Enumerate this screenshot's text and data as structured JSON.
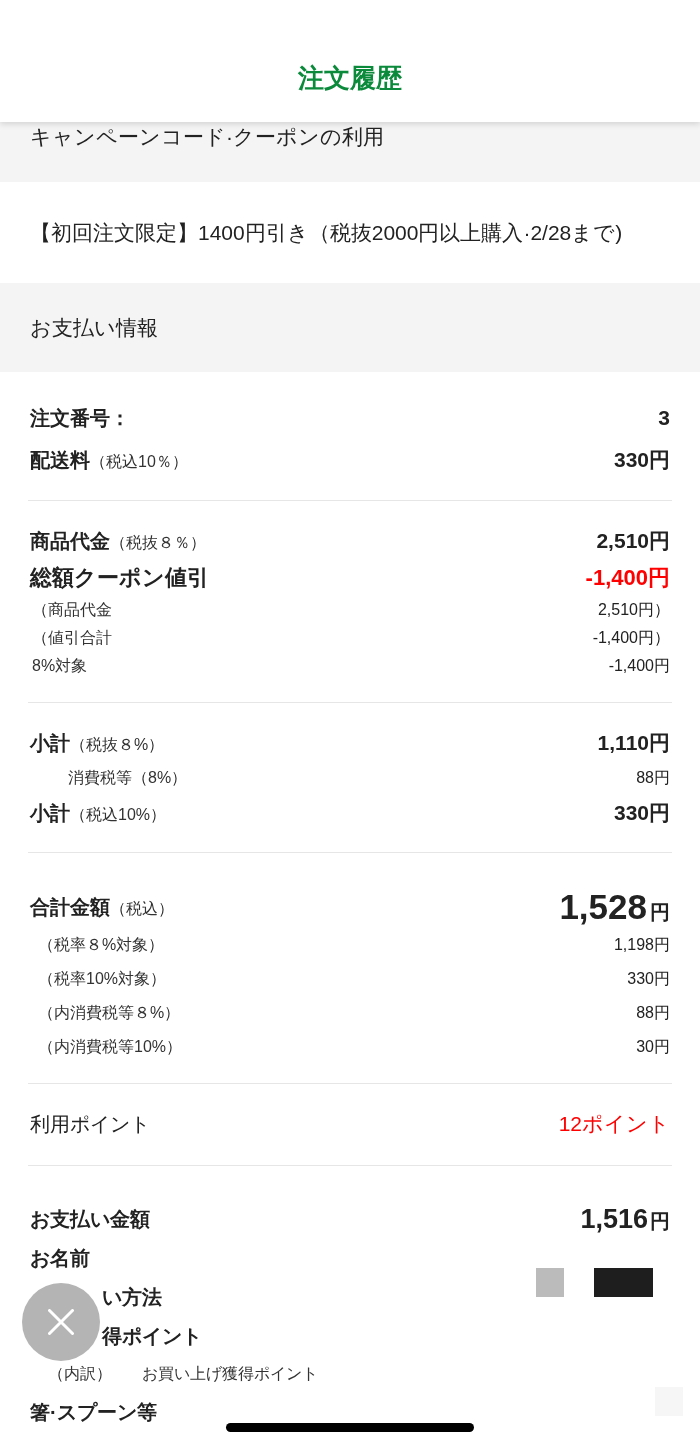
{
  "header": {
    "title": "注文履歴"
  },
  "coupon_section": {
    "heading": "キャンペーンコード·クーポンの利用",
    "coupon": "【初回注文限定】1400円引き（税抜2000円以上購入·2/28まで)"
  },
  "payment_section": {
    "heading": "お支払い情報",
    "groups": [
      {
        "rows": [
          {
            "kind": "main",
            "label": "注文番号：",
            "value": "3"
          },
          {
            "kind": "main",
            "label": "配送料",
            "note": "（税込10％）",
            "value": "330円"
          }
        ]
      },
      {
        "rows": [
          {
            "kind": "main",
            "label": "商品代金",
            "note": "（税抜８％）",
            "value": "2,510円"
          },
          {
            "kind": "emphasis",
            "label": "総額クーポン値引",
            "value": "-1,400円",
            "color": "#ff0000"
          },
          {
            "kind": "detail",
            "label": "（商品代金",
            "value": "2,510円）"
          },
          {
            "kind": "detail",
            "label": "（値引合計",
            "value": "-1,400円）"
          },
          {
            "kind": "detail",
            "label": "8%対象",
            "value": "-1,400円"
          }
        ]
      },
      {
        "rows": [
          {
            "kind": "main",
            "label": "小計",
            "note": "（税抜８%）",
            "value": "1,110円"
          },
          {
            "kind": "tax",
            "label": "消費税等（8%）",
            "value": "88円"
          },
          {
            "kind": "main",
            "label": "小計",
            "note": "（税込10%）",
            "value": "330円"
          }
        ]
      },
      {
        "rows": [
          {
            "kind": "total",
            "label": "合計金額",
            "note": "（税込）",
            "value": "1,528",
            "unit": "円"
          },
          {
            "kind": "breakdown",
            "label": "（税率８%対象）",
            "value": "1,198円"
          },
          {
            "kind": "breakdown",
            "label": "（税率10%対象）",
            "value": "330円"
          },
          {
            "kind": "breakdown",
            "label": "（内消費税等８%）",
            "value": "88円"
          },
          {
            "kind": "breakdown",
            "label": "（内消費税等10%）",
            "value": "30円"
          }
        ]
      },
      {
        "rows": [
          {
            "kind": "points",
            "label": "利用ポイント",
            "value": "12ポイント",
            "color": "#ff0000"
          }
        ]
      },
      {
        "rows": [
          {
            "kind": "payment",
            "label": "お支払い金額",
            "value": "1,516",
            "unit": "円"
          },
          {
            "kind": "label",
            "label": "お名前"
          },
          {
            "kind": "obscured",
            "label": "い方法"
          },
          {
            "kind": "obscured",
            "label": "得ポイント"
          },
          {
            "kind": "note_pair",
            "label": "（内訳）",
            "value": "お買い上げ獲得ポイント"
          },
          {
            "kind": "label",
            "label": "箸·スプーン等"
          }
        ]
      }
    ]
  }
}
